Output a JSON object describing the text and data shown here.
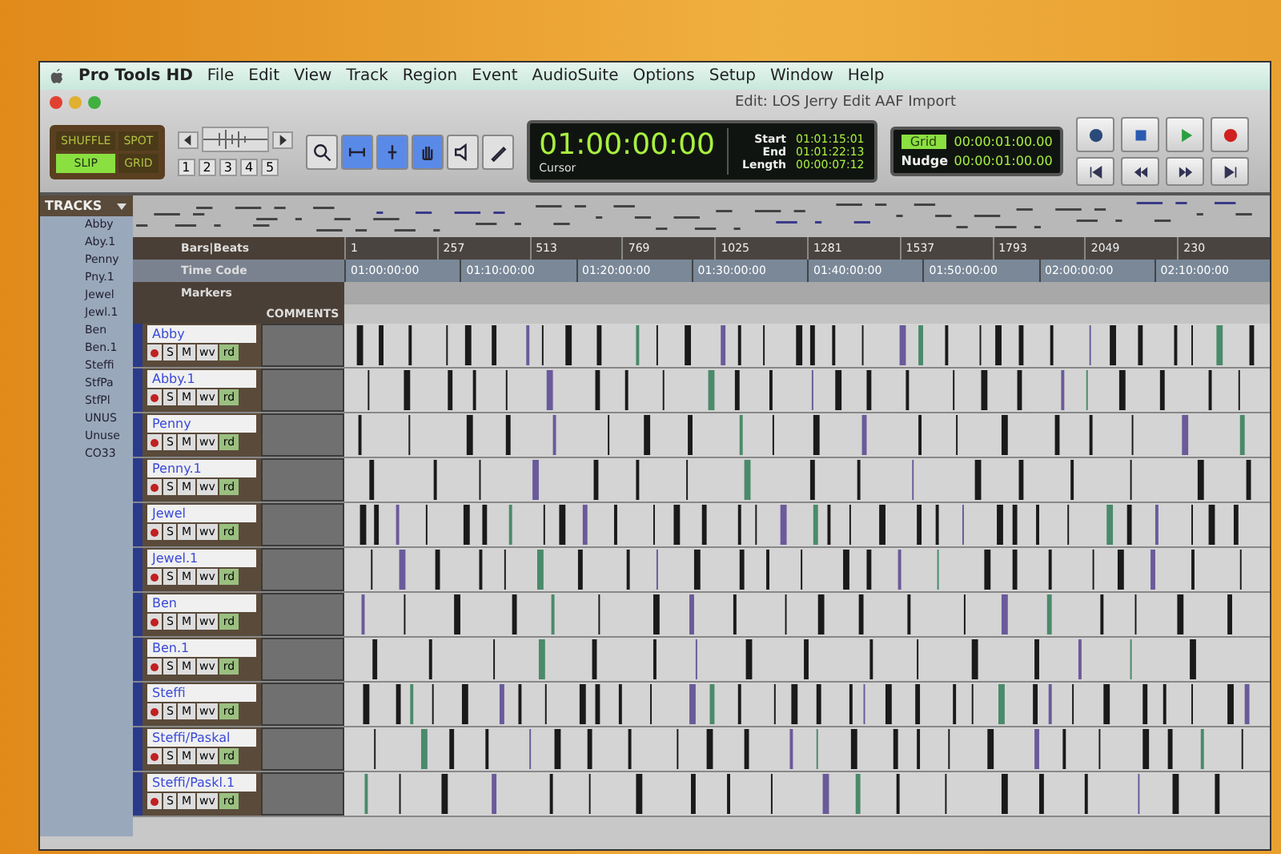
{
  "window": {
    "title": "Edit: LOS Jerry Edit AAF Import"
  },
  "menu_bar": {
    "app": "Pro Tools HD",
    "items": [
      "File",
      "Edit",
      "View",
      "Track",
      "Region",
      "Event",
      "AudioSuite",
      "Options",
      "Setup",
      "Window",
      "Help"
    ]
  },
  "edit_modes": [
    {
      "label": "SHUFFLE",
      "selected": false
    },
    {
      "label": "SPOT",
      "selected": false
    },
    {
      "label": "SLIP",
      "selected": true
    },
    {
      "label": "GRID",
      "selected": false
    }
  ],
  "zoom_presets": [
    "1",
    "2",
    "3",
    "4",
    "5"
  ],
  "tools": [
    {
      "kind": "zoom",
      "selected": false
    },
    {
      "kind": "trim",
      "selected": true
    },
    {
      "kind": "select",
      "selected": true
    },
    {
      "kind": "grab",
      "selected": true
    },
    {
      "kind": "scrub",
      "selected": false
    },
    {
      "kind": "pencil",
      "selected": false
    }
  ],
  "counter": {
    "main": "01:00:00:00",
    "cursor_label": "Cursor",
    "start_label": "Start",
    "start": "01:01:15:01",
    "end_label": "End",
    "end": "01:01:22:13",
    "length_label": "Length",
    "length": "00:00:07:12"
  },
  "grid": {
    "label": "Grid",
    "value": "00:00:01:00.00",
    "selected": true
  },
  "nudge": {
    "label": "Nudge",
    "value": "00:00:01:00.00",
    "selected": false
  },
  "transport": [
    {
      "kind": "online"
    },
    {
      "kind": "stop"
    },
    {
      "kind": "play"
    },
    {
      "kind": "record"
    },
    {
      "kind": "start"
    },
    {
      "kind": "rewind"
    },
    {
      "kind": "forward"
    },
    {
      "kind": "end"
    }
  ],
  "tracks_list": {
    "title": "TRACKS",
    "items": [
      "Abby",
      "Aby.1",
      "Penny",
      "Pny.1",
      "Jewel",
      "Jewl.1",
      "Ben",
      "Ben.1",
      "Steffi",
      "StfPa",
      "StfPl",
      "UNUS",
      "Unuse",
      "CO33"
    ]
  },
  "bars_beats": {
    "label": "Bars|Beats",
    "marks": [
      "1",
      "257",
      "513",
      "769",
      "1025",
      "1281",
      "1537",
      "1793",
      "2049",
      "230"
    ]
  },
  "time_code": {
    "label": "Time Code",
    "marks": [
      "01:00:00:00",
      "01:10:00:00",
      "01:20:00:00",
      "01:30:00:00",
      "01:40:00:00",
      "01:50:00:00",
      "02:00:00:00",
      "02:10:00:00"
    ]
  },
  "markers": {
    "label": "Markers"
  },
  "comments_heading": "COMMENTS",
  "tracks": [
    {
      "name": "Abby",
      "solo": "S",
      "mute": "M",
      "view": "wv",
      "automation": "rd"
    },
    {
      "name": "Abby.1",
      "solo": "S",
      "mute": "M",
      "view": "wv",
      "automation": "rd"
    },
    {
      "name": "Penny",
      "solo": "S",
      "mute": "M",
      "view": "wv",
      "automation": "rd"
    },
    {
      "name": "Penny.1",
      "solo": "S",
      "mute": "M",
      "view": "wv",
      "automation": "rd"
    },
    {
      "name": "Jewel",
      "solo": "S",
      "mute": "M",
      "view": "wv",
      "automation": "rd"
    },
    {
      "name": "Jewel.1",
      "solo": "S",
      "mute": "M",
      "view": "wv",
      "automation": "rd"
    },
    {
      "name": "Ben",
      "solo": "S",
      "mute": "M",
      "view": "wv",
      "automation": "rd"
    },
    {
      "name": "Ben.1",
      "solo": "S",
      "mute": "M",
      "view": "wv",
      "automation": "rd"
    },
    {
      "name": "Steffi",
      "solo": "S",
      "mute": "M",
      "view": "wv",
      "automation": "rd"
    },
    {
      "name": "Steffi/Paskal",
      "solo": "S",
      "mute": "M",
      "view": "wv",
      "automation": "rd"
    },
    {
      "name": "Steffi/Paskl.1",
      "solo": "S",
      "mute": "M",
      "view": "wv",
      "automation": "rd"
    }
  ]
}
